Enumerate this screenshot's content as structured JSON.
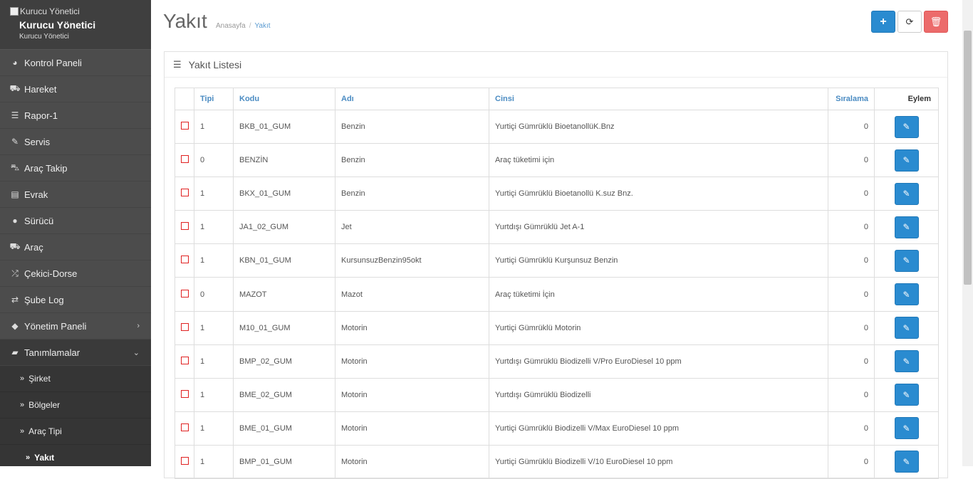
{
  "brand": {
    "logo_alt": "Kurucu Yönetici",
    "title": "Kurucu Yönetici",
    "subtitle": "Kurucu Yönetici"
  },
  "sidebar": {
    "items": [
      {
        "label": "Kontrol Paneli",
        "icon": "dashboard-icon",
        "glyph": "◕"
      },
      {
        "label": "Hareket",
        "icon": "truck-icon",
        "glyph": "⛟"
      },
      {
        "label": "Rapor-1",
        "icon": "list-icon",
        "glyph": "☰"
      },
      {
        "label": "Servis",
        "icon": "wrench-icon",
        "glyph": "✎"
      },
      {
        "label": "Araç Takip",
        "icon": "car-icon",
        "glyph": "⛍"
      },
      {
        "label": "Evrak",
        "icon": "newspaper-icon",
        "glyph": "▤"
      },
      {
        "label": "Sürücü",
        "icon": "user-icon",
        "glyph": "●"
      },
      {
        "label": "Araç",
        "icon": "truck-icon",
        "glyph": "⛟"
      },
      {
        "label": "Çekici-Dorse",
        "icon": "random-icon",
        "glyph": "⤮"
      },
      {
        "label": "Şube Log",
        "icon": "exchange-icon",
        "glyph": "⇄"
      },
      {
        "label": "Yönetim Paneli",
        "icon": "tags-icon",
        "glyph": "◆",
        "chevron": "›"
      },
      {
        "label": "Tanımlamalar",
        "icon": "folder-icon",
        "glyph": "▰",
        "chevron": "⌄"
      }
    ],
    "subitems": [
      {
        "label": "Şirket"
      },
      {
        "label": "Bölgeler"
      },
      {
        "label": "Araç Tipi"
      },
      {
        "label": "Yakıt"
      }
    ]
  },
  "page": {
    "title": "Yakıt",
    "breadcrumb_home": "Anasayfa",
    "breadcrumb_sep": "/",
    "breadcrumb_current": "Yakıt"
  },
  "toolbar": {
    "add_glyph": "+",
    "refresh_glyph": "⟳",
    "delete_glyph": "🗑"
  },
  "portlet": {
    "title": "Yakıt Listesi"
  },
  "table": {
    "headers": {
      "tipi": "Tipi",
      "kodu": "Kodu",
      "adi": "Adı",
      "cinsi": "Cinsi",
      "siralama": "Sıralama",
      "eylem": "Eylem"
    },
    "rows": [
      {
        "tipi": "1",
        "kodu": "BKB_01_GUM",
        "adi": "Benzin",
        "cinsi": "Yurtiçi Gümrüklü BioetanollüK.Bnz",
        "siralama": "0"
      },
      {
        "tipi": "0",
        "kodu": "BENZİN",
        "adi": "Benzin",
        "cinsi": "Araç tüketimi için",
        "siralama": "0"
      },
      {
        "tipi": "1",
        "kodu": "BKX_01_GUM",
        "adi": "Benzin",
        "cinsi": "Yurtiçi Gümrüklü Bioetanollü K.suz Bnz.",
        "siralama": "0"
      },
      {
        "tipi": "1",
        "kodu": "JA1_02_GUM",
        "adi": "Jet",
        "cinsi": "Yurtdışı Gümrüklü Jet A-1",
        "siralama": "0"
      },
      {
        "tipi": "1",
        "kodu": "KBN_01_GUM",
        "adi": "KursunsuzBenzin95okt",
        "cinsi": "Yurtiçi Gümrüklü Kurşunsuz Benzin",
        "siralama": "0"
      },
      {
        "tipi": "0",
        "kodu": "MAZOT",
        "adi": "Mazot",
        "cinsi": "Araç tüketimi İçin",
        "siralama": "0"
      },
      {
        "tipi": "1",
        "kodu": "M10_01_GUM",
        "adi": "Motorin",
        "cinsi": "Yurtiçi Gümrüklü Motorin",
        "siralama": "0"
      },
      {
        "tipi": "1",
        "kodu": "BMP_02_GUM",
        "adi": "Motorin",
        "cinsi": "Yurtdışı Gümrüklü Biodizelli V/Pro EuroDiesel 10 ppm",
        "siralama": "0"
      },
      {
        "tipi": "1",
        "kodu": "BME_02_GUM",
        "adi": "Motorin",
        "cinsi": "Yurtdışı Gümrüklü Biodizelli",
        "siralama": "0"
      },
      {
        "tipi": "1",
        "kodu": "BME_01_GUM",
        "adi": "Motorin",
        "cinsi": "Yurtiçi Gümrüklü Biodizelli V/Max EuroDiesel 10 ppm",
        "siralama": "0"
      },
      {
        "tipi": "1",
        "kodu": "BMP_01_GUM",
        "adi": "Motorin",
        "cinsi": "Yurtiçi Gümrüklü Biodizelli V/10 EuroDiesel 10 ppm",
        "siralama": "0"
      }
    ]
  },
  "colors": {
    "sidebar_bg": "#4c4c4c",
    "primary": "#2a8bd0",
    "danger": "#ec6b6b",
    "header_link": "#4a8bc2"
  }
}
